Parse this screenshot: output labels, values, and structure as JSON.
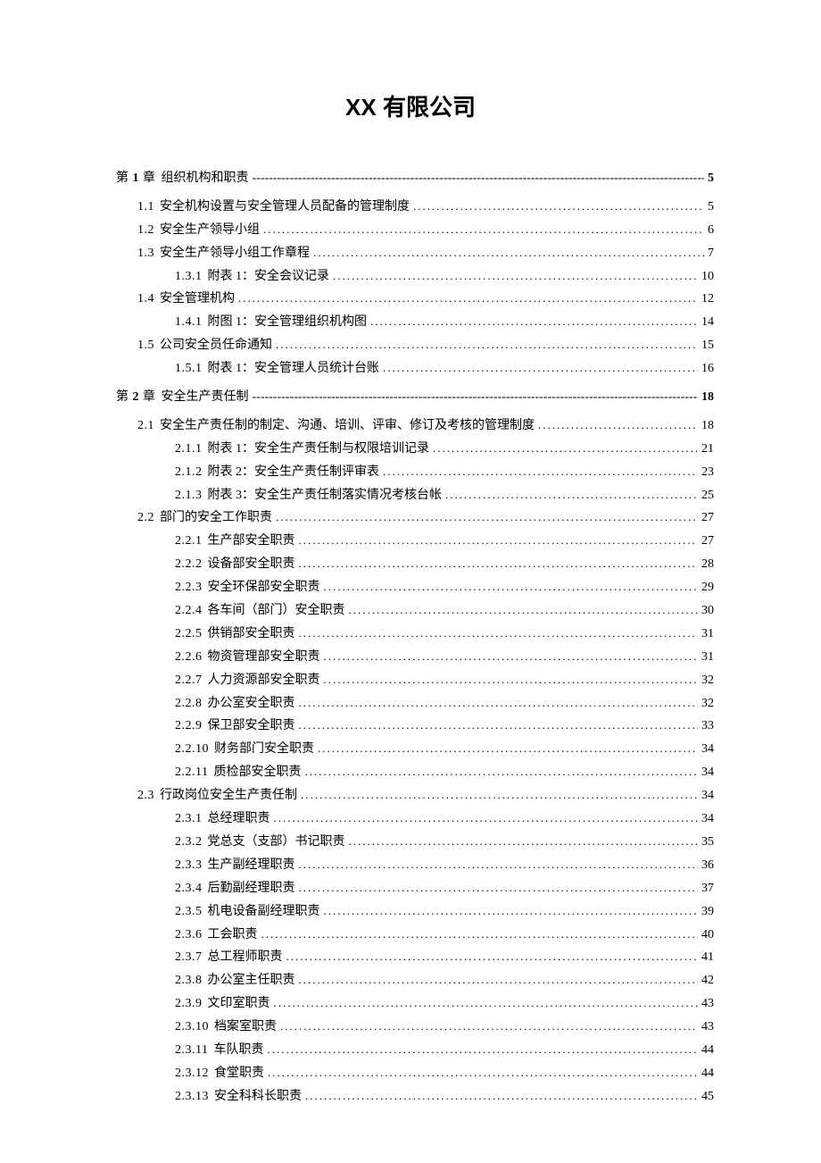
{
  "title": "XX 有限公司",
  "toc": [
    {
      "type": "chapter",
      "prefix": "第 ",
      "numBold": "1",
      "suffix": " 章",
      "label": "组织机构和职责",
      "page": "5",
      "leader": "dashes"
    },
    {
      "type": "l1",
      "num": "1.1",
      "label": "安全机构设置与安全管理人员配备的管理制度",
      "page": "5"
    },
    {
      "type": "l1",
      "num": "1.2",
      "label": "安全生产领导小组",
      "page": "6"
    },
    {
      "type": "l1",
      "num": "1.3",
      "label": "安全生产领导小组工作章程",
      "page": "7"
    },
    {
      "type": "l2",
      "num": "1.3.1",
      "label": "附表 1：安全会议记录",
      "page": "10"
    },
    {
      "type": "l1",
      "num": "1.4",
      "label": "安全管理机构",
      "page": "12"
    },
    {
      "type": "l2",
      "num": "1.4.1",
      "label": "附图 1：安全管理组织机构图",
      "page": "14"
    },
    {
      "type": "l1",
      "num": "1.5",
      "label": "公司安全员任命通知",
      "page": "15"
    },
    {
      "type": "l2",
      "num": "1.5.1",
      "label": "附表 1：安全管理人员统计台账",
      "page": "16"
    },
    {
      "type": "chapter",
      "prefix": "第 ",
      "numBold": "2",
      "suffix": " 章",
      "label": "安全生产责任制",
      "page": "18",
      "leader": "dashes"
    },
    {
      "type": "l1",
      "num": "2.1",
      "label": "安全生产责任制的制定、沟通、培训、评审、修订及考核的管理制度",
      "page": "18"
    },
    {
      "type": "l2",
      "num": "2.1.1",
      "label": "附表 1：安全生产责任制与权限培训记录",
      "page": "21"
    },
    {
      "type": "l2",
      "num": "2.1.2",
      "label": "附表 2：安全生产责任制评审表",
      "page": "23"
    },
    {
      "type": "l2",
      "num": "2.1.3",
      "label": "附表 3：安全生产责任制落实情况考核台帐",
      "page": "25"
    },
    {
      "type": "l1",
      "num": "2.2",
      "label": "部门的安全工作职责",
      "page": "27"
    },
    {
      "type": "l2",
      "num": "2.2.1",
      "label": "生产部安全职责",
      "page": "27"
    },
    {
      "type": "l2",
      "num": "2.2.2",
      "label": "设备部安全职责",
      "page": "28"
    },
    {
      "type": "l2",
      "num": "2.2.3",
      "label": "安全环保部安全职责",
      "page": "29"
    },
    {
      "type": "l2",
      "num": "2.2.4",
      "label": "各车间（部门）安全职责",
      "page": "30"
    },
    {
      "type": "l2",
      "num": "2.2.5",
      "label": "供销部安全职责",
      "page": "31"
    },
    {
      "type": "l2",
      "num": "2.2.6",
      "label": "物资管理部安全职责",
      "page": "31"
    },
    {
      "type": "l2",
      "num": "2.2.7",
      "label": "人力资源部安全职责",
      "page": "32"
    },
    {
      "type": "l2",
      "num": "2.2.8",
      "label": "办公室安全职责",
      "page": "32"
    },
    {
      "type": "l2",
      "num": "2.2.9",
      "label": "保卫部安全职责",
      "page": "33"
    },
    {
      "type": "l2",
      "num": "2.2.10",
      "label": "财务部门安全职责",
      "page": "34"
    },
    {
      "type": "l2",
      "num": "2.2.11",
      "label": "质检部安全职责",
      "page": "34"
    },
    {
      "type": "l1",
      "num": "2.3",
      "label": "行政岗位安全生产责任制",
      "page": "34"
    },
    {
      "type": "l2",
      "num": "2.3.1",
      "label": "总经理职责",
      "page": "34"
    },
    {
      "type": "l2",
      "num": "2.3.2",
      "label": "党总支（支部）书记职责",
      "page": "35"
    },
    {
      "type": "l2",
      "num": "2.3.3",
      "label": "生产副经理职责",
      "page": "36"
    },
    {
      "type": "l2",
      "num": "2.3.4",
      "label": "后勤副经理职责",
      "page": "37"
    },
    {
      "type": "l2",
      "num": "2.3.5",
      "label": "机电设备副经理职责",
      "page": "39"
    },
    {
      "type": "l2",
      "num": "2.3.6",
      "label": "工会职责",
      "page": "40"
    },
    {
      "type": "l2",
      "num": "2.3.7",
      "label": "总工程师职责",
      "page": "41"
    },
    {
      "type": "l2",
      "num": "2.3.8",
      "label": "办公室主任职责",
      "page": "42"
    },
    {
      "type": "l2",
      "num": "2.3.9",
      "label": "文印室职责",
      "page": "43"
    },
    {
      "type": "l2",
      "num": "2.3.10",
      "label": "档案室职责",
      "page": "43"
    },
    {
      "type": "l2",
      "num": "2.3.11",
      "label": "车队职责",
      "page": "44"
    },
    {
      "type": "l2",
      "num": "2.3.12",
      "label": "食堂职责",
      "page": "44"
    },
    {
      "type": "l2",
      "num": "2.3.13",
      "label": "安全科科长职责",
      "page": "45"
    }
  ]
}
